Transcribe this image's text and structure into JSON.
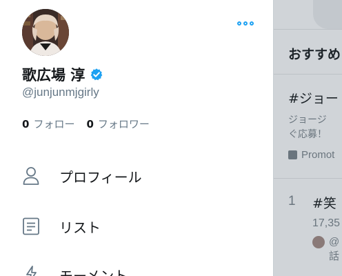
{
  "profile": {
    "display_name": "歌広場 淳",
    "handle": "@junjunmjgirly",
    "following_count": "0",
    "following_label": "フォロー",
    "followers_count": "0",
    "followers_label": "フォロワー"
  },
  "menu": {
    "items": [
      {
        "label": "プロフィール",
        "icon": "person-icon"
      },
      {
        "label": "リスト",
        "icon": "list-icon"
      },
      {
        "label": "モーメント",
        "icon": "moments-icon"
      }
    ]
  },
  "background": {
    "section_heading": "おすすめ",
    "promoted_trend": {
      "tag": "#ジョー",
      "description_line1": "ジョージ",
      "description_line2": "ぐ応募！",
      "promoted_label": "Promot"
    },
    "trend_1": {
      "rank": "1",
      "tag": "#笑",
      "count": "17,35",
      "user": "@",
      "talk": "話"
    }
  },
  "colors": {
    "accent": "#1da1f2",
    "text_primary": "#14171a",
    "text_secondary": "#657786",
    "overlay": "#d0d4d8"
  }
}
